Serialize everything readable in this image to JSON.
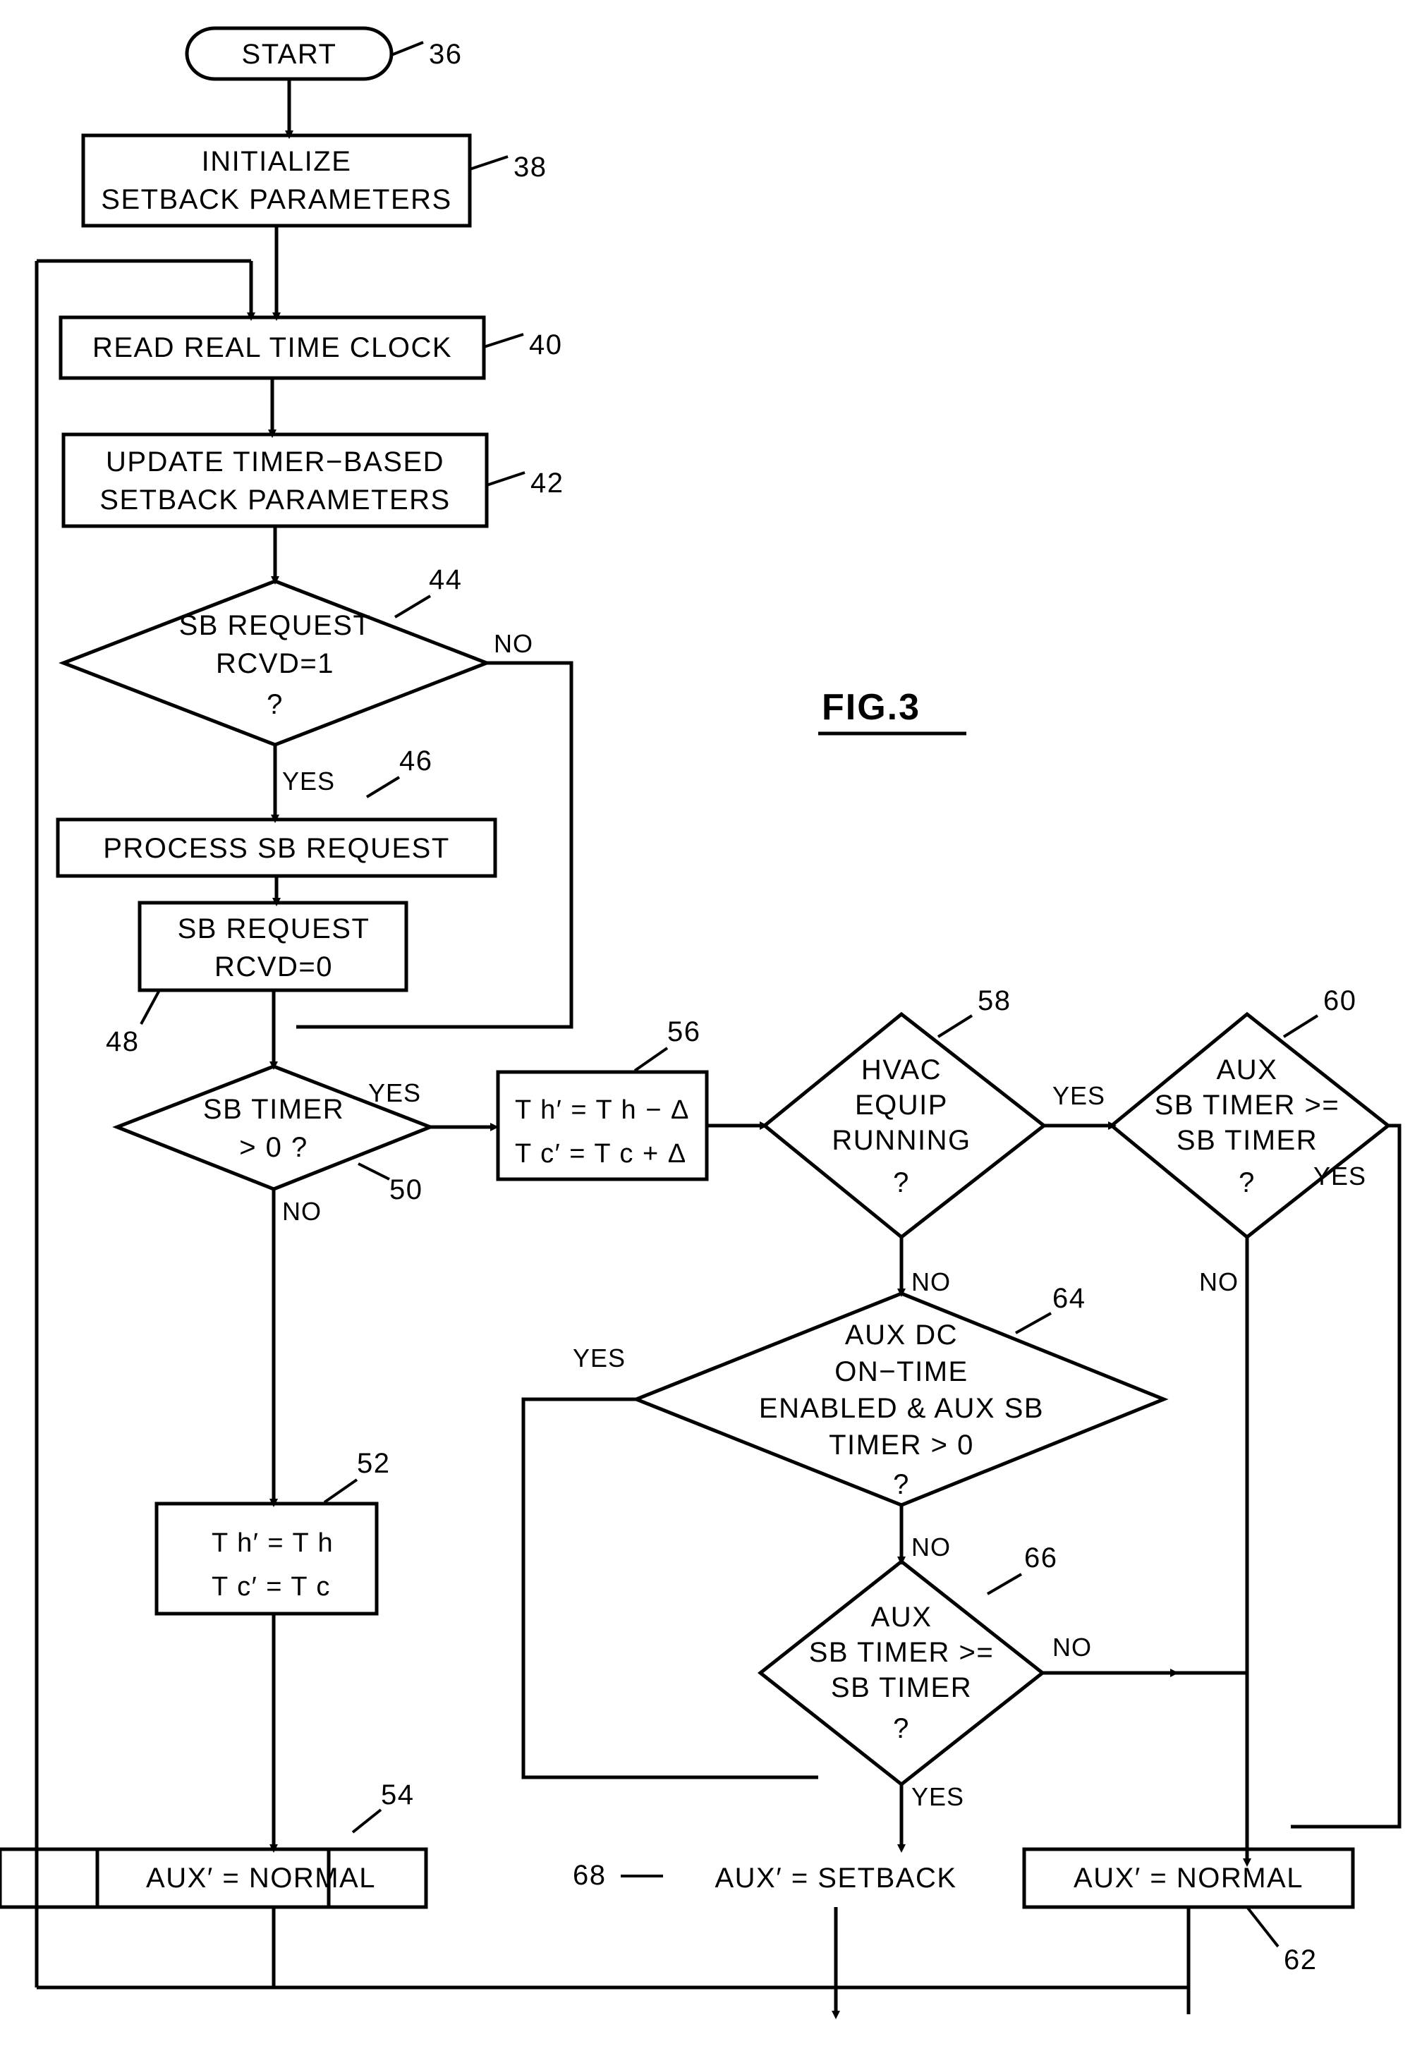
{
  "figure": {
    "title": "FIG.3",
    "type": "flowchart"
  },
  "nodes": {
    "start": {
      "ref": "36",
      "label": "START",
      "shape": "terminator"
    },
    "init": {
      "ref": "38",
      "label_line1": "INITIALIZE",
      "label_line2": "SETBACK  PARAMETERS",
      "shape": "process"
    },
    "read_clock": {
      "ref": "40",
      "label": "READ  REAL  TIME  CLOCK",
      "shape": "process"
    },
    "update_timer": {
      "ref": "42",
      "label_line1": "UPDATE  TIMER−BASED",
      "label_line2": "SETBACK  PARAMETERS",
      "shape": "process"
    },
    "sb_request_rcvd": {
      "ref": "44",
      "label_line1": "SB  REQUEST",
      "label_line2": "RCVD=1",
      "label_line3": "?",
      "shape": "decision",
      "yes": "YES",
      "no": "NO"
    },
    "process_sb": {
      "ref": "46",
      "label": "PROCESS  SB  REQUEST",
      "shape": "process"
    },
    "clear_sb": {
      "ref": "48",
      "label_line1": "SB  REQUEST",
      "label_line2": "RCVD=0",
      "shape": "process"
    },
    "sb_timer": {
      "ref": "50",
      "label_line1": "SB  TIMER",
      "label_line2": "> 0  ?",
      "shape": "decision",
      "yes": "YES",
      "no": "NO"
    },
    "setpoint_offset": {
      "ref": "56",
      "label_line1": "T h′ = T h − Δ",
      "label_line2": "T c′ = T c + Δ",
      "shape": "process"
    },
    "hvac_running": {
      "ref": "58",
      "label_line1": "HVAC",
      "label_line2": "EQUIP",
      "label_line3": "RUNNING",
      "label_line4": "?",
      "shape": "decision",
      "yes": "YES",
      "no": "NO"
    },
    "aux_sb_timer_top": {
      "ref": "60",
      "label_line1": "AUX",
      "label_line2": "SB  TIMER  >=",
      "label_line3": "SB  TIMER",
      "label_line4": "?",
      "shape": "decision",
      "yes": "YES",
      "no": "NO"
    },
    "aux_dc_ontime": {
      "ref": "64",
      "label_line1": "AUX  DC",
      "label_line2": "ON−TIME",
      "label_line3": "ENABLED & AUX SB",
      "label_line4": "TIMER > 0",
      "label_line5": "?",
      "shape": "decision",
      "yes": "YES",
      "no": "NO"
    },
    "aux_sb_timer_bottom": {
      "ref": "66",
      "label_line1": "AUX",
      "label_line2": "SB  TIMER  >=",
      "label_line3": "SB  TIMER",
      "label_line4": "?",
      "shape": "decision",
      "yes": "YES",
      "no": "NO"
    },
    "setpoint_normal": {
      "ref": "52",
      "label_line1": "T h′ = T h",
      "label_line2": "T c′ = T c",
      "shape": "process"
    },
    "aux_normal_left": {
      "ref": "54",
      "label": "AUX′  =  NORMAL",
      "shape": "process"
    },
    "aux_setback": {
      "ref": "68",
      "label": "AUX′  =  SETBACK",
      "shape": "process"
    },
    "aux_normal_right": {
      "ref": "62",
      "label": "AUX′  =  NORMAL",
      "shape": "process"
    }
  },
  "edge_labels": {
    "sb_request_no": "NO",
    "sb_request_yes": "YES",
    "sb_timer_yes": "YES",
    "sb_timer_no": "NO",
    "hvac_yes": "YES",
    "hvac_no": "NO",
    "aux60_yes": "YES",
    "aux60_no": "NO",
    "aux64_yes": "YES",
    "aux64_no": "NO",
    "aux66_no": "NO",
    "aux66_yes": "YES"
  }
}
